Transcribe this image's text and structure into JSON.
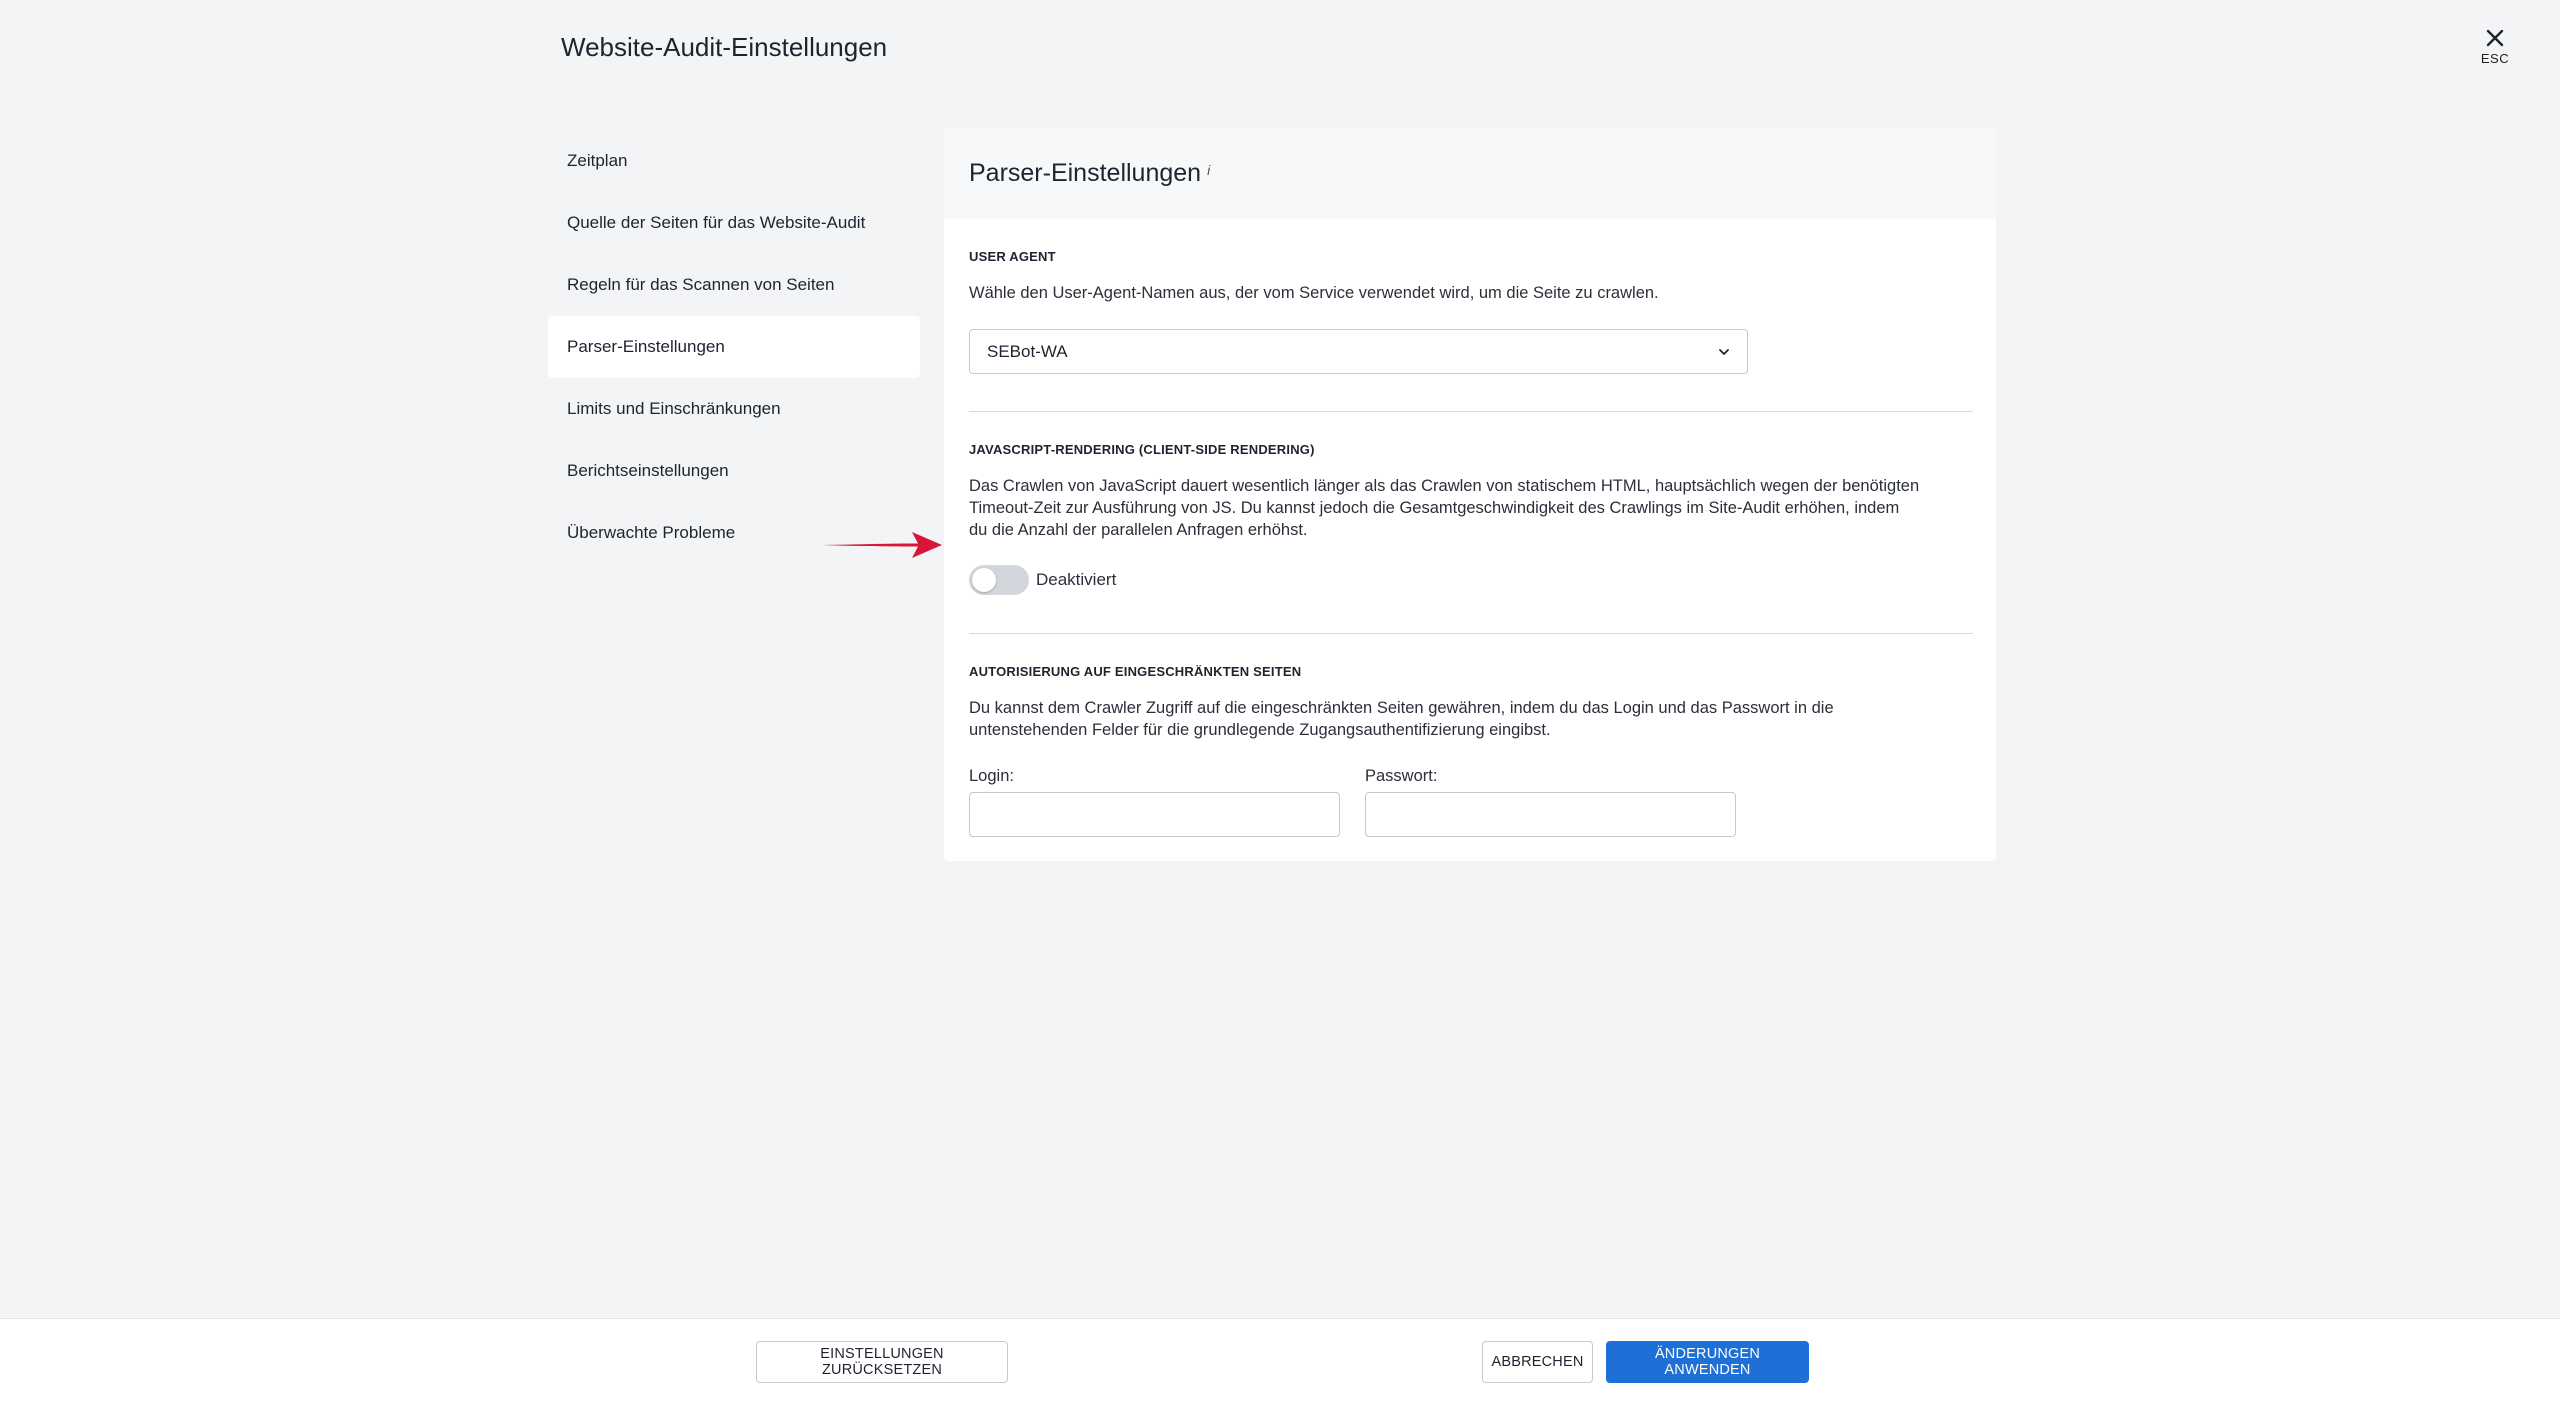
{
  "header": {
    "title": "Website-Audit-Einstellungen",
    "close_label": "ESC"
  },
  "sidebar": {
    "items": [
      {
        "label": "Zeitplan",
        "active": false
      },
      {
        "label": "Quelle der Seiten für das Website-Audit",
        "active": false
      },
      {
        "label": "Regeln für das Scannen von Seiten",
        "active": false
      },
      {
        "label": "Parser-Einstellungen",
        "active": true
      },
      {
        "label": "Limits und Einschränkungen",
        "active": false
      },
      {
        "label": "Berichtseinstellungen",
        "active": false
      },
      {
        "label": "Überwachte Probleme",
        "active": false
      }
    ]
  },
  "panel": {
    "title": "Parser-Einstellungen",
    "info_marker": "i",
    "user_agent": {
      "title": "USER AGENT",
      "description": "Wähle den User-Agent-Namen aus, der vom Service verwendet wird, um die Seite zu crawlen.",
      "selected": "SEBot-WA"
    },
    "js_rendering": {
      "title": "JAVASCRIPT-RENDERING (CLIENT-SIDE RENDERING)",
      "line1": "Das Crawlen von JavaScript dauert wesentlich länger als das Crawlen von statischem HTML, hauptsächlich wegen der benötigten",
      "line2": "Timeout-Zeit zur Ausführung von JS. Du kannst jedoch die Gesamtgeschwindigkeit des Crawlings im Site-Audit erhöhen, indem",
      "line3": "du die Anzahl der parallelen Anfragen erhöhst.",
      "toggle_enabled": false,
      "toggle_label": "Deaktiviert"
    },
    "authorization": {
      "title": "AUTORISIERUNG AUF EINGESCHRÄNKTEN SEITEN",
      "line1": "Du kannst dem Crawler Zugriff auf die eingeschränkten Seiten gewähren, indem du das Login und das Passwort in die",
      "line2": "untenstehenden Felder für die grundlegende Zugangsauthentifizierung eingibst.",
      "login_label": "Login:",
      "login_value": "",
      "password_label": "Passwort:",
      "password_value": ""
    }
  },
  "footer": {
    "reset_label": "EINSTELLUNGEN ZURÜCKSETZEN",
    "cancel_label": "ABBRECHEN",
    "apply_label": "ÄNDERUNGEN ANWENDEN"
  },
  "colors": {
    "primary": "#1e6fd6",
    "arrow": "#d9163a",
    "background": "#f3f4f6"
  },
  "icons": {
    "close": "close-icon",
    "chevron": "chevron-down-icon",
    "arrow": "arrow-right-icon"
  }
}
